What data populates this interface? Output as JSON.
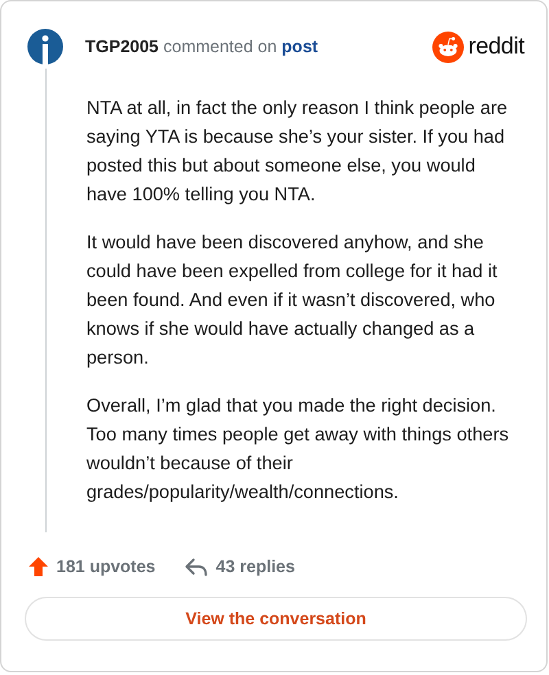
{
  "comment": {
    "author": "TGP2005",
    "action": "commented on",
    "target": "post",
    "paragraphs": [
      "NTA at all, in fact the only reason I think people are saying YTA is because she’s your sister. If you had posted this but about someone else, you would have 100% telling you NTA.",
      "It would have been discovered anyhow, and she could have been expelled from college for it had it been found. And even if it wasn’t discovered, who knows if she would have actually changed as a person.",
      "Overall, I’m glad that you made the right decision. Too many times people get away with things others wouldn’t because of their grades/popularity/wealth/connections."
    ]
  },
  "brand": "reddit",
  "stats": {
    "upvotes": "181 upvotes",
    "replies": "43 replies"
  },
  "button": "View the conversation"
}
